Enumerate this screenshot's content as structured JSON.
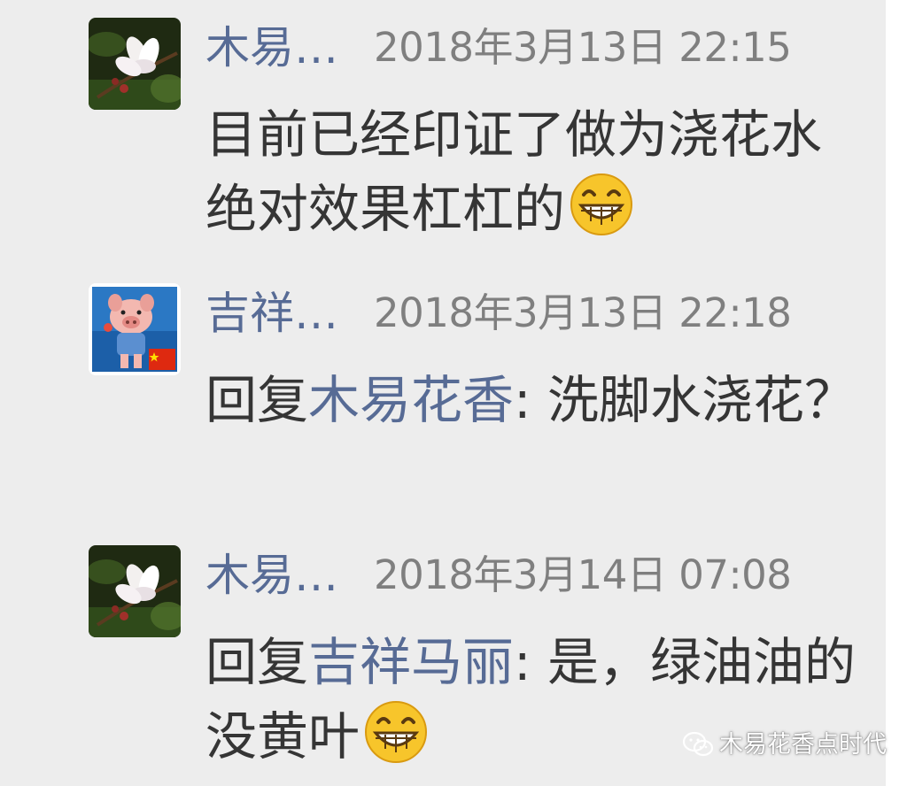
{
  "comments": [
    {
      "nickname": "木易…",
      "time": "2018年3月13日 22:15",
      "content_before": "目前已经印证了做为浇花水绝对效果杠杠的",
      "reply_prefix": "",
      "reply_to": "",
      "content_after": "",
      "emoji": "grin-emoji",
      "avatar": "flower-avatar"
    },
    {
      "nickname": "吉祥…",
      "time": "2018年3月13日 22:18",
      "content_before": "",
      "reply_prefix": "回复",
      "reply_to": "木易花香",
      "content_after": ": 洗脚水浇花？",
      "emoji": "",
      "avatar": "pig-avatar"
    },
    {
      "nickname": "木易…",
      "time": "2018年3月14日 07:08",
      "content_before": "",
      "reply_prefix": "回复",
      "reply_to": "吉祥马丽",
      "content_after": ": 是，绿油油的没黄叶",
      "emoji": "grin-emoji",
      "avatar": "flower-avatar"
    }
  ],
  "watermark": {
    "text": "木易花香点时代",
    "icon": "wechat-icon"
  },
  "colors": {
    "background": "#ededed",
    "name_blue": "#576b95",
    "time_gray": "#7f7f7f",
    "text": "#353535"
  }
}
